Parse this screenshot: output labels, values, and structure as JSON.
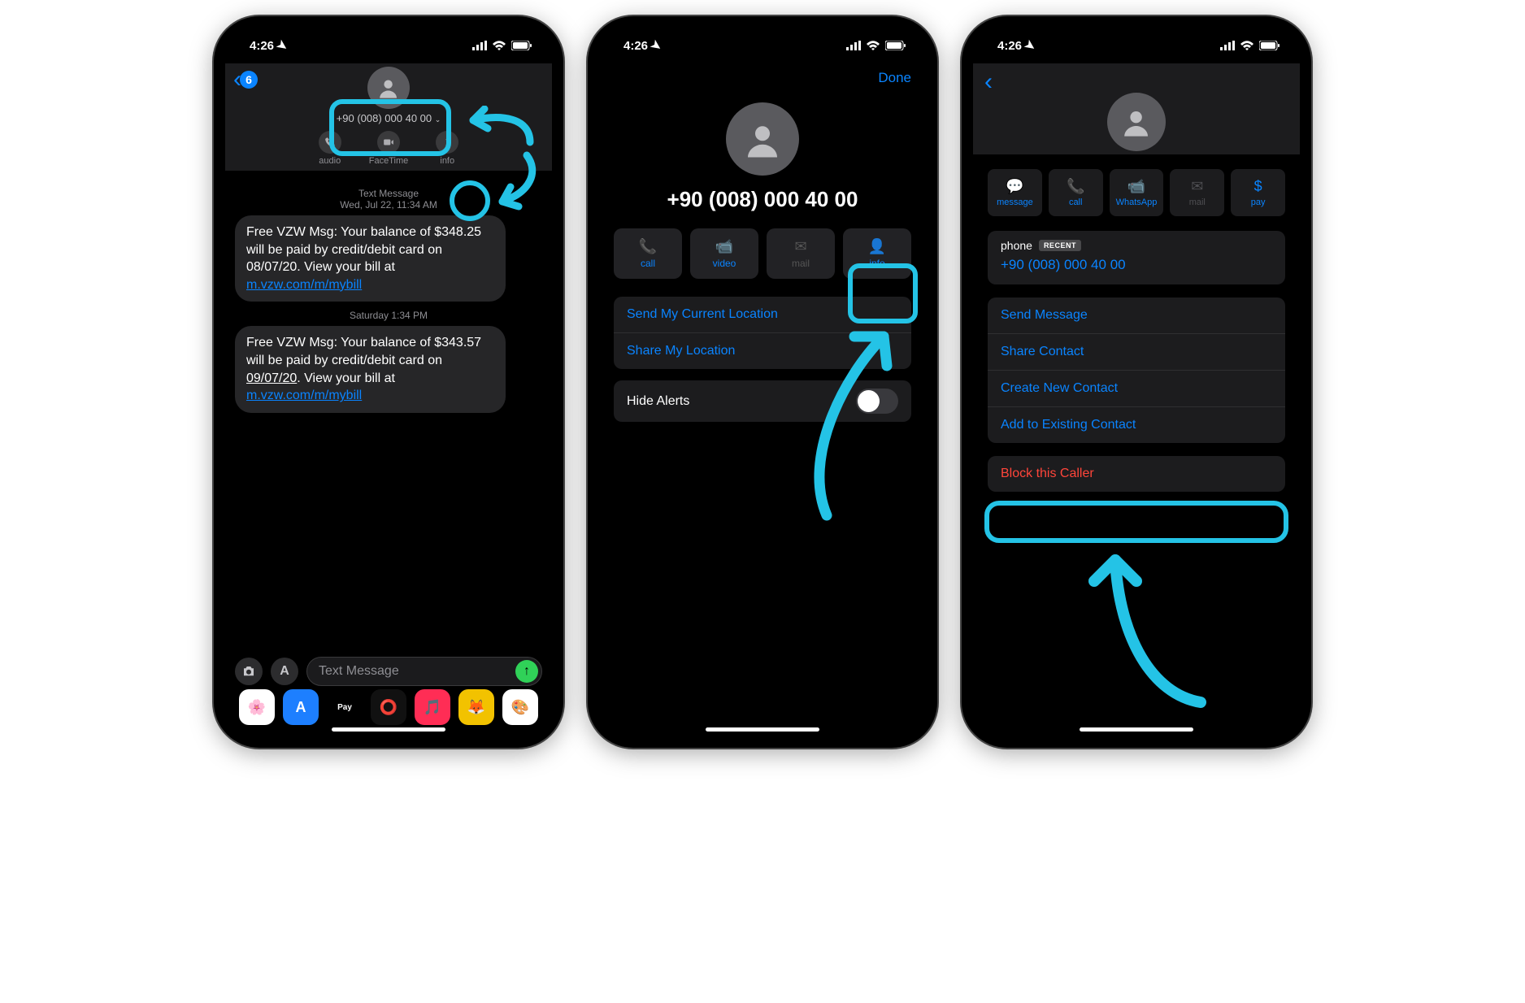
{
  "status": {
    "time": "4:26",
    "location_icon": "◤"
  },
  "colors": {
    "accent_cyan": "#24c3e6",
    "ios_blue": "#0a84ff",
    "ios_red": "#ff453a",
    "ios_green": "#30d158"
  },
  "screen1": {
    "back_count": "6",
    "contact_number": "+90 (008) 000 40 00",
    "actions": {
      "audio": "audio",
      "facetime": "FaceTime",
      "info": "info"
    },
    "messages": [
      {
        "header_line1": "Text Message",
        "header_line2": "Wed, Jul 22, 11:34 AM",
        "body_pre": "Free VZW Msg: Your balance of $348.25 will be paid by credit/debit card on 08/07/20. View your bill at ",
        "link": "m.vzw.com/m/mybill"
      },
      {
        "header_line1": "Saturday 1:34 PM",
        "body_pre": "Free VZW Msg: Your balance of $343.57 will be paid by credit/debit card on ",
        "underlined": "09/07/20",
        "body_post": ". View your bill at ",
        "link": "m.vzw.com/m/mybill"
      }
    ],
    "input_placeholder": "Text Message"
  },
  "screen2": {
    "done": "Done",
    "contact_number": "+90 (008) 000 40 00",
    "actions": {
      "call": "call",
      "video": "video",
      "mail": "mail",
      "info": "info"
    },
    "rows": {
      "send_location": "Send My Current Location",
      "share_location": "Share My Location",
      "hide_alerts": "Hide Alerts"
    }
  },
  "screen3": {
    "actions": {
      "message": "message",
      "call": "call",
      "whatsapp": "WhatsApp",
      "mail": "mail",
      "pay": "pay"
    },
    "phone_label": "phone",
    "recent_badge": "RECENT",
    "phone_number": "+90 (008) 000 40 00",
    "rows": {
      "send_message": "Send Message",
      "share_contact": "Share Contact",
      "create_contact": "Create New Contact",
      "add_existing": "Add to Existing Contact"
    },
    "block_caller": "Block this Caller"
  }
}
